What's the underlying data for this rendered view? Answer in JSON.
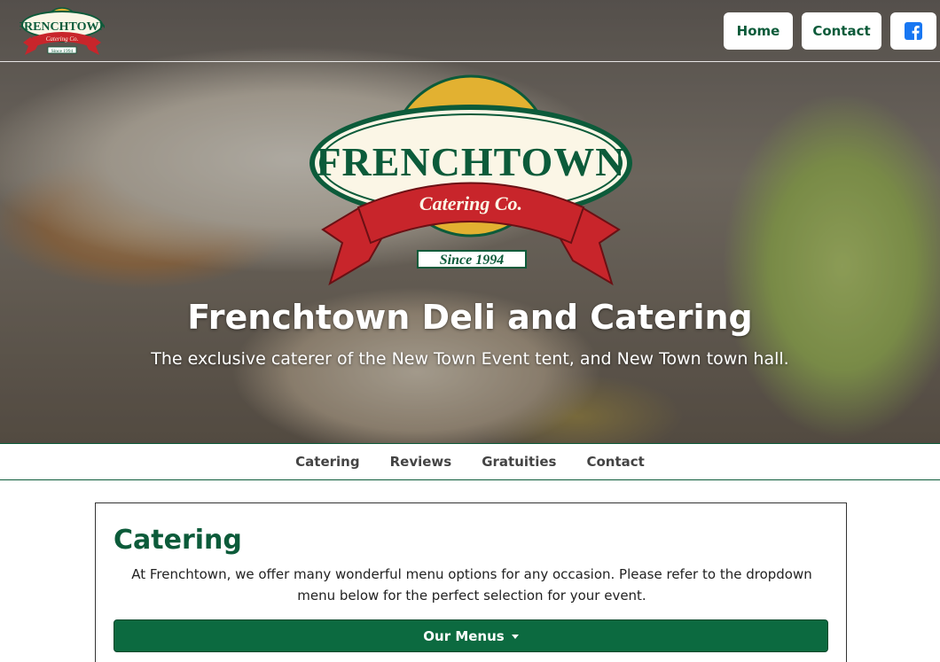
{
  "header": {
    "logo_alt": "Frenchtown Catering Co. Since 1994",
    "nav": {
      "home": "Home",
      "contact": "Contact",
      "facebook_icon": "facebook-icon"
    }
  },
  "logo": {
    "brand": "FRENCHTOWN",
    "ribbon": "Catering Co.",
    "since": "Since 1994",
    "colors": {
      "green": "#0c5b3a",
      "gold": "#e2b131",
      "red": "#c8252b",
      "cream": "#fbf6e6"
    }
  },
  "hero": {
    "title": "Frenchtown Deli and Catering",
    "subtitle": "The exclusive caterer of the New Town Event tent, and New Town town hall."
  },
  "section_nav": {
    "items": [
      {
        "label": "Catering"
      },
      {
        "label": "Reviews"
      },
      {
        "label": "Gratuities"
      },
      {
        "label": "Contact"
      }
    ]
  },
  "catering": {
    "title": "Catering",
    "text": "At Frenchtown, we offer many wonderful menu options for any occasion. Please refer to the dropdown menu below for the perfect selection for your event.",
    "menus_button": "Our Menus",
    "accent": "#0c6a40"
  }
}
